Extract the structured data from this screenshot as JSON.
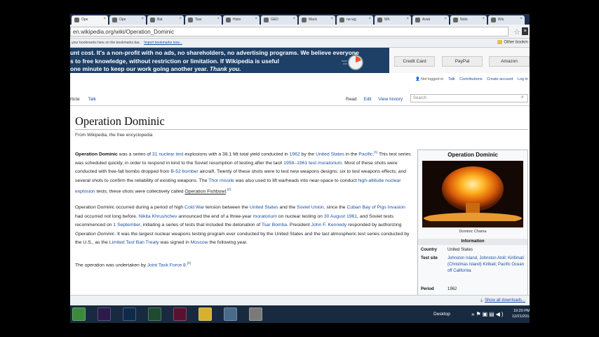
{
  "browser": {
    "tabs": [
      {
        "label": "Ope",
        "active": true
      },
      {
        "label": "Ope"
      },
      {
        "label": "Bat"
      },
      {
        "label": "Tsar"
      },
      {
        "label": "Histo"
      },
      {
        "label": "GED"
      },
      {
        "label": "Mack"
      },
      {
        "label": "ne-wg"
      },
      {
        "label": "Wh"
      },
      {
        "label": "Aviat"
      },
      {
        "label": "Noto"
      },
      {
        "label": "Wis"
      }
    ],
    "url": "en.wikipedia.org/wiki/Operation_Dominic",
    "bookmarks_text": "your bookmarks here on the bookmarks bar.",
    "import_bookmarks": "Import bookmarks now...",
    "other_bookmarks": "Other bookm"
  },
  "banner": {
    "line1": "unt cost. It's a non-profit with no ads, no shareholders, no advertising programs. We believe everyone",
    "line2": "s to free knowledge, without restriction or limitation. If Wikipedia is useful",
    "line3_prefix": "one minute to keep our work going another year.",
    "line3_emph": "Thank you.",
    "buttons": [
      "Credit Card",
      "PayPal",
      "Amazon"
    ]
  },
  "personal": {
    "not_logged_in": "Not logged in",
    "talk": "Talk",
    "contributions": "Contributions",
    "create_account": "Create account",
    "login": "Log in"
  },
  "page_tabs": {
    "article": "rticle",
    "talk": "Talk",
    "read": "Read",
    "edit": "Edit",
    "view_history": "View history",
    "search_placeholder": "Search"
  },
  "article": {
    "title": "Operation Dominic",
    "from": "From Wikipedia, the free encyclopedia",
    "p1": {
      "bold": "Operation Dominic",
      "t1": " was a series of ",
      "l1": "31",
      "l2": "nuclear test",
      "t2": " explosions with a 38.1 Mt total yield conducted in ",
      "l3": "1962",
      "t3": " by the ",
      "l4": "United States",
      "t4": " in the ",
      "l5": "Pacific",
      "r1": "[1]",
      "t5": " This test series was scheduled quickly, in order to respond in kind to the Soviet resumption of testing after the tacit ",
      "l6": "1958–1961 test moratorium",
      "t6": ". Most of these shots were conducted with free-fall bombs dropped from ",
      "l7": "B-52 bomber",
      "t7": " aircraft. Twenty of these shots were to test new weapons designs; six to test weapons effects; and several shots to confirm the reliability of existing weapons. The ",
      "l8": "Thor missile",
      "t8": " was also used to lift warheads into near-space to conduct ",
      "l9": "high-altitude nuclear explosion",
      "t9": " tests; these shots were collectively called ",
      "l10": "Operation Fishbowl",
      "r2": "[2]"
    },
    "p2": {
      "t1": "Operation Dominic occurred during a period of high ",
      "l1": "Cold War",
      "t2": " tension between the ",
      "l2": "United States",
      "t3": " and the ",
      "l3": "Soviet Union",
      "t4": ", since the ",
      "l4": "Cuban Bay of Pigs Invasion",
      "t5": " had occurred not long before. ",
      "l5": "Nikita Khrushchev",
      "t6": " announced the end of a three-year ",
      "l6": "moratorium",
      "t7": " on nuclear testing on ",
      "l7": "30 August",
      "t8": " ",
      "l8": "1961",
      "t9": ", and Soviet tests recommenced on ",
      "l9": "1 September",
      "t10": ", initiating a series of tests that included the detonation of ",
      "l10": "Tsar Bomba",
      "t11": ". President ",
      "l11": "John F. Kennedy",
      "t12": " responded by authorizing ",
      "i1": "Operation Dominic",
      "t13": ". It was the largest nuclear weapons testing program ever conducted by the United States and the last atmospheric test series conducted by the U.S., as the ",
      "l12": "Limited Test Ban Treaty",
      "t14": " was signed in ",
      "l13": "Moscow",
      "t15": " the following year."
    },
    "p3": {
      "t1": "The operation was undertaken by ",
      "l1": "Joint Task Force 8",
      "t2": ".",
      "r1": "[3]"
    }
  },
  "infobox": {
    "title": "Operation Dominic",
    "caption": "Dominic Chama",
    "section": "Information",
    "country_label": "Country",
    "country_value": "United States",
    "site_label": "Test site",
    "site_value": "Johnston Island, Johnston Atoll; Kiritimati (Christmas Island) Kiribati; Pacific Ocean off California",
    "period_label": "Period",
    "period_value": "1962"
  },
  "downloads": {
    "show_all": "Show all downloads..."
  },
  "taskbar": {
    "apps": [
      {
        "label": "Chrome",
        "color": "#3a8a3a"
      },
      {
        "label": "Pr",
        "color": "#2b1a4a"
      },
      {
        "label": "Ps",
        "color": "#0e2a4a"
      },
      {
        "label": "Dw",
        "color": "#1e4a30"
      },
      {
        "label": "Id",
        "color": "#5a1030"
      },
      {
        "label": "Files",
        "color": "#d8b030"
      },
      {
        "label": "Media",
        "color": "#4a6a8a"
      },
      {
        "label": "User",
        "color": "#7a7a7a"
      }
    ],
    "desktop": "Desktop",
    "clock_time": "10:20 PM",
    "clock_date": "12/21/2014"
  },
  "colors": {
    "banner_bg": "#1e3f66",
    "link": "#1a4fa6",
    "taskbar_bg": "#172a3f"
  }
}
